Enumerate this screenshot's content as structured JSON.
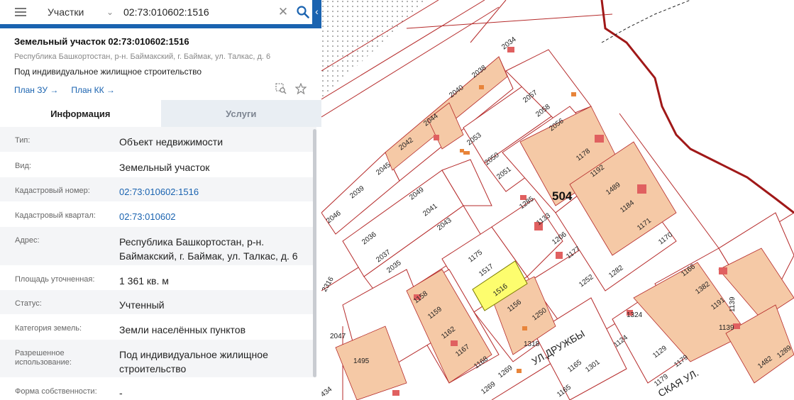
{
  "search": {
    "type_label": "Участки",
    "query": "02:73:010602:1516"
  },
  "card": {
    "title": "Земельный участок 02:73:010602:1516",
    "address": "Республика Башкортостан, р-н. Баймакский, г. Баймак, ул. Талкас, д. 6",
    "use": "Под индивидуальное жилищное строительство",
    "link_zu": "План ЗУ →",
    "link_kk": "План КК →"
  },
  "tabs": [
    {
      "label": "Информация",
      "active": true
    },
    {
      "label": "Услуги",
      "active": false
    }
  ],
  "info": [
    {
      "key": "Тип:",
      "value": "Объект недвижимости"
    },
    {
      "key": "Вид:",
      "value": "Земельный участок"
    },
    {
      "key": "Кадастровый номер:",
      "value": "02:73:010602:1516"
    },
    {
      "key": "Кадастровый квартал:",
      "value": "02:73:010602"
    },
    {
      "key": "Адрес:",
      "value": "Республика Башкортостан, р-н. Баймакский, г. Баймак, ул. Талкас, д. 6"
    },
    {
      "key": "Площадь уточненная:",
      "value": "1 361 кв. м"
    },
    {
      "key": "Статус:",
      "value": "Учтенный"
    },
    {
      "key": "Категория земель:",
      "value": "Земли населённых пунктов"
    },
    {
      "key": "Разрешенное использование:",
      "value": "Под индивидуальное жилищное строительство"
    },
    {
      "key": "Форма собственности:",
      "value": "-"
    }
  ],
  "map": {
    "block_number": "504",
    "street_label": "УЛ.ДРУЖБЫ",
    "street_label_2": "СКАЯ УЛ.",
    "highlighted_parcel": "1516",
    "colors": {
      "accent": "#1a63b0",
      "parcel_line": "#b52a2a",
      "building_fill": "#f5c9a6",
      "highlight_fill": "#fdfd6e",
      "river": "#a01818"
    },
    "parcels": [
      {
        "id": "2034"
      },
      {
        "id": "2038"
      },
      {
        "id": "2040"
      },
      {
        "id": "2044"
      },
      {
        "id": "2042"
      },
      {
        "id": "2045"
      },
      {
        "id": "2039"
      },
      {
        "id": "2046"
      },
      {
        "id": "2036"
      },
      {
        "id": "2037"
      },
      {
        "id": "2035"
      },
      {
        "id": "2049"
      },
      {
        "id": "2041"
      },
      {
        "id": "2043"
      },
      {
        "id": "2053"
      },
      {
        "id": "2050"
      },
      {
        "id": "2051"
      },
      {
        "id": "2057"
      },
      {
        "id": "2058"
      },
      {
        "id": "2056"
      },
      {
        "id": "1178"
      },
      {
        "id": "1192"
      },
      {
        "id": "1489"
      },
      {
        "id": "1184"
      },
      {
        "id": "1171"
      },
      {
        "id": "1170"
      },
      {
        "id": "1285"
      },
      {
        "id": "1133"
      },
      {
        "id": "1206"
      },
      {
        "id": "1177"
      },
      {
        "id": "1252"
      },
      {
        "id": "1282"
      },
      {
        "id": "1175"
      },
      {
        "id": "1517"
      },
      {
        "id": "1516"
      },
      {
        "id": "1156"
      },
      {
        "id": "1250"
      },
      {
        "id": "1318"
      },
      {
        "id": "1158"
      },
      {
        "id": "1159"
      },
      {
        "id": "1162"
      },
      {
        "id": "1167"
      },
      {
        "id": "1168"
      },
      {
        "id": "1269"
      },
      {
        "id": "1166"
      },
      {
        "id": "1382"
      },
      {
        "id": "1191"
      },
      {
        "id": "1139"
      },
      {
        "id": "1324"
      },
      {
        "id": "1124"
      },
      {
        "id": "1129"
      },
      {
        "id": "1179"
      },
      {
        "id": "1301"
      },
      {
        "id": "1165"
      },
      {
        "id": "1495"
      },
      {
        "id": "2047"
      },
      {
        "id": "1482"
      },
      {
        "id": "1289"
      },
      {
        "id": "2316"
      },
      {
        "id": "434"
      }
    ]
  }
}
